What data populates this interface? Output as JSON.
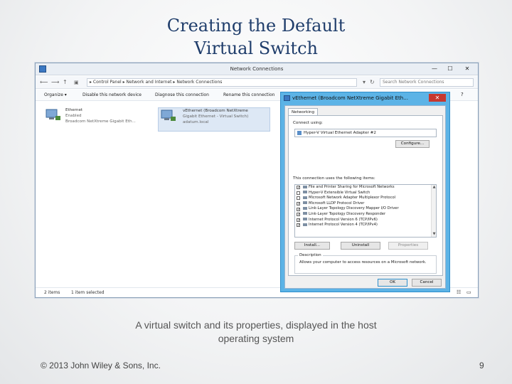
{
  "slide": {
    "title_line1": "Creating the Default",
    "title_line2": "Virtual Switch",
    "caption_line1": "A virtual switch and its properties, displayed in the host",
    "caption_line2": "operating system",
    "copyright": "© 2013 John Wiley & Sons, Inc.",
    "page_number": "9"
  },
  "window": {
    "title": "Network Connections",
    "minimize": "—",
    "maximize": "☐",
    "close": "✕",
    "address": "▸ Control Panel ▸ Network and Internet ▸ Network Connections",
    "search_placeholder": "Search Network Connections",
    "toolbar": [
      "Organize ▾",
      "Disable this network device",
      "Diagnose this connection",
      "Rename this connection"
    ],
    "adapters": [
      {
        "name": "Ethernet",
        "status": "Enabled",
        "device": "Broadcom NetXtreme Gigabit Eth..."
      },
      {
        "name": "vEthernet (Broadcom NetXtreme",
        "status": "Gigabit Ethernet - Virtual Switch)",
        "device": "adatum.local"
      }
    ],
    "status_items": "2 items",
    "status_selected": "1 item selected"
  },
  "dialog": {
    "title": "vEthernet (Broadcom NetXtreme Gigabit Eth...",
    "close": "✕",
    "tab": "Networking",
    "connect_using_label": "Connect using:",
    "adapter_name": "Hyper-V Virtual Ethernet Adapter #2",
    "configure": "Configure...",
    "components_label": "This connection uses the following items:",
    "components": [
      {
        "label": "File and Printer Sharing for Microsoft Networks",
        "checked": true
      },
      {
        "label": "Hyper-V Extensible Virtual Switch",
        "checked": false
      },
      {
        "label": "Microsoft Network Adapter Multiplexor Protocol",
        "checked": false
      },
      {
        "label": "Microsoft LLDP Protocol Driver",
        "checked": true
      },
      {
        "label": "Link-Layer Topology Discovery Mapper I/O Driver",
        "checked": true
      },
      {
        "label": "Link-Layer Topology Discovery Responder",
        "checked": true
      },
      {
        "label": "Internet Protocol Version 6 (TCP/IPv6)",
        "checked": true
      },
      {
        "label": "Internet Protocol Version 4 (TCP/IPv4)",
        "checked": true
      }
    ],
    "install": "Install...",
    "uninstall": "Uninstall",
    "properties": "Properties",
    "description_label": "Description",
    "description_text": "Allows your computer to access resources on a Microsoft network.",
    "ok": "OK",
    "cancel": "Cancel"
  },
  "colors": {
    "title_color": "#1f3d6b",
    "dialog_frame": "#5cb3e6",
    "close_button": "#c7382f"
  }
}
